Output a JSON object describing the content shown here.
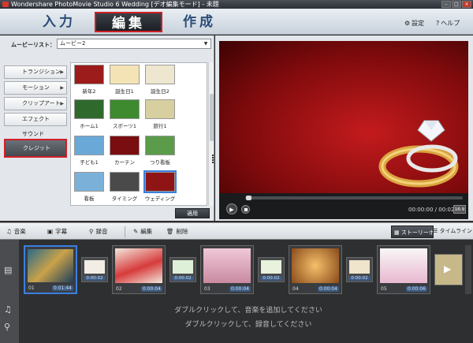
{
  "window": {
    "title": "Wondershare PhotoMovie Studio 6 Wedding [デオ編集モード] - 未題"
  },
  "nav": {
    "tabs": [
      "入力",
      "編集",
      "作成"
    ],
    "settings": "設定",
    "help": "ヘルプ"
  },
  "left": {
    "movie_list_label": "ムービーリスト：",
    "movie_list_value": "ムービー2",
    "categories": [
      "トランジション",
      "モーション",
      "クリップアート",
      "エフェクト",
      "サウンド",
      "クレジット"
    ],
    "templates": [
      {
        "label": "新年2",
        "color": "#9b1c1a"
      },
      {
        "label": "誕生日1",
        "color": "#f4e3b5"
      },
      {
        "label": "誕生日2",
        "color": "#efe6cf"
      },
      {
        "label": "ホーム1",
        "color": "#2f6a2c"
      },
      {
        "label": "スポーツ1",
        "color": "#3d8a2f"
      },
      {
        "label": "旅行1",
        "color": "#d8cfa0"
      },
      {
        "label": "子ども1",
        "color": "#6aa8d8"
      },
      {
        "label": "カーテン",
        "color": "#7a0d10"
      },
      {
        "label": "つり看板",
        "color": "#5b9c4a"
      },
      {
        "label": "看板",
        "color": "#7bb1d9"
      },
      {
        "label": "タイミング",
        "color": "#4a4a4a"
      },
      {
        "label": "ウェディング",
        "color": "#8e1416"
      }
    ],
    "apply_label": "適用"
  },
  "preview": {
    "time": "00:00:00 / 00:02:10",
    "ratio": "16:9"
  },
  "toolbar": {
    "music": "音楽",
    "subtitle": "字幕",
    "record": "録音",
    "edit": "編集",
    "delete": "削除",
    "storyboard": "ストーリーボード",
    "timeline": "タイムライン"
  },
  "storyboard": {
    "clips": [
      {
        "num": "01",
        "dur": "0:01:44",
        "color": "#2a6a88"
      },
      {
        "num": "02",
        "dur": "0:00:04",
        "color": "#d63b3b"
      },
      {
        "num": "03",
        "dur": "0:00:04",
        "color": "#c98aa0"
      },
      {
        "num": "04",
        "dur": "0:00:04",
        "color": "#e09a3a"
      },
      {
        "num": "05",
        "dur": "0:00:06",
        "color": "#e8b8d0"
      }
    ],
    "transitions": [
      {
        "dur": "0:00:02"
      },
      {
        "dur": "0:00:02"
      },
      {
        "dur": "0:00:02"
      },
      {
        "dur": "0:00:02"
      }
    ],
    "music_hint": "ダブルクリックして、音楽を追加してください",
    "record_hint": "ダブルクリックして、録音してください"
  },
  "colors": {
    "accent_red": "#d01f26",
    "selection_blue": "#3b7fe0"
  }
}
